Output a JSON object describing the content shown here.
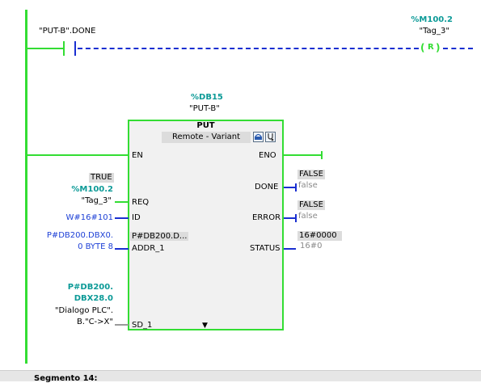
{
  "top_contact": {
    "operand": "\"PUT-B\".DONE"
  },
  "top_coil": {
    "address": "%M100.2",
    "tag": "\"Tag_3\"",
    "coil_label": "R"
  },
  "block": {
    "db_address": "%DB15",
    "db_name": "\"PUT-B\"",
    "type": "PUT",
    "subtitle": "Remote - Variant",
    "expand_symbol": "▼",
    "pins": {
      "en": "EN",
      "eno": "ENO",
      "req": "REQ",
      "id": "ID",
      "addr_1": "ADDR_1",
      "sd_1": "SD_1",
      "done": "DONE",
      "error": "ERROR",
      "status": "STATUS",
      "addr_1_inner_value": "P#DB200.D..."
    }
  },
  "inputs": {
    "req_monitor": "TRUE",
    "req_address": "%M100.2",
    "req_tag": "\"Tag_3\"",
    "id_value": "W#16#101",
    "addr_1_line1": "P#DB200.DBX0.",
    "addr_1_line2": "0 BYTE 8",
    "sd_1_address_line1": "P#DB200.",
    "sd_1_address_line2": "DBX28.0",
    "sd_1_tag_line1": "\"Dialogo PLC\".",
    "sd_1_tag_line2": "B.\"C->X\""
  },
  "outputs": {
    "done_monitor": "FALSE",
    "done_value": "false",
    "error_monitor": "FALSE",
    "error_value": "false",
    "status_monitor": "16#0000",
    "status_value": "16#0"
  },
  "next_segment": {
    "label": "Segmento 14:"
  },
  "colors": {
    "power_flow": "#33dd33",
    "no_flow": "#1a2fd1",
    "address": "#0c9a97",
    "constant": "#1c3fd6"
  }
}
